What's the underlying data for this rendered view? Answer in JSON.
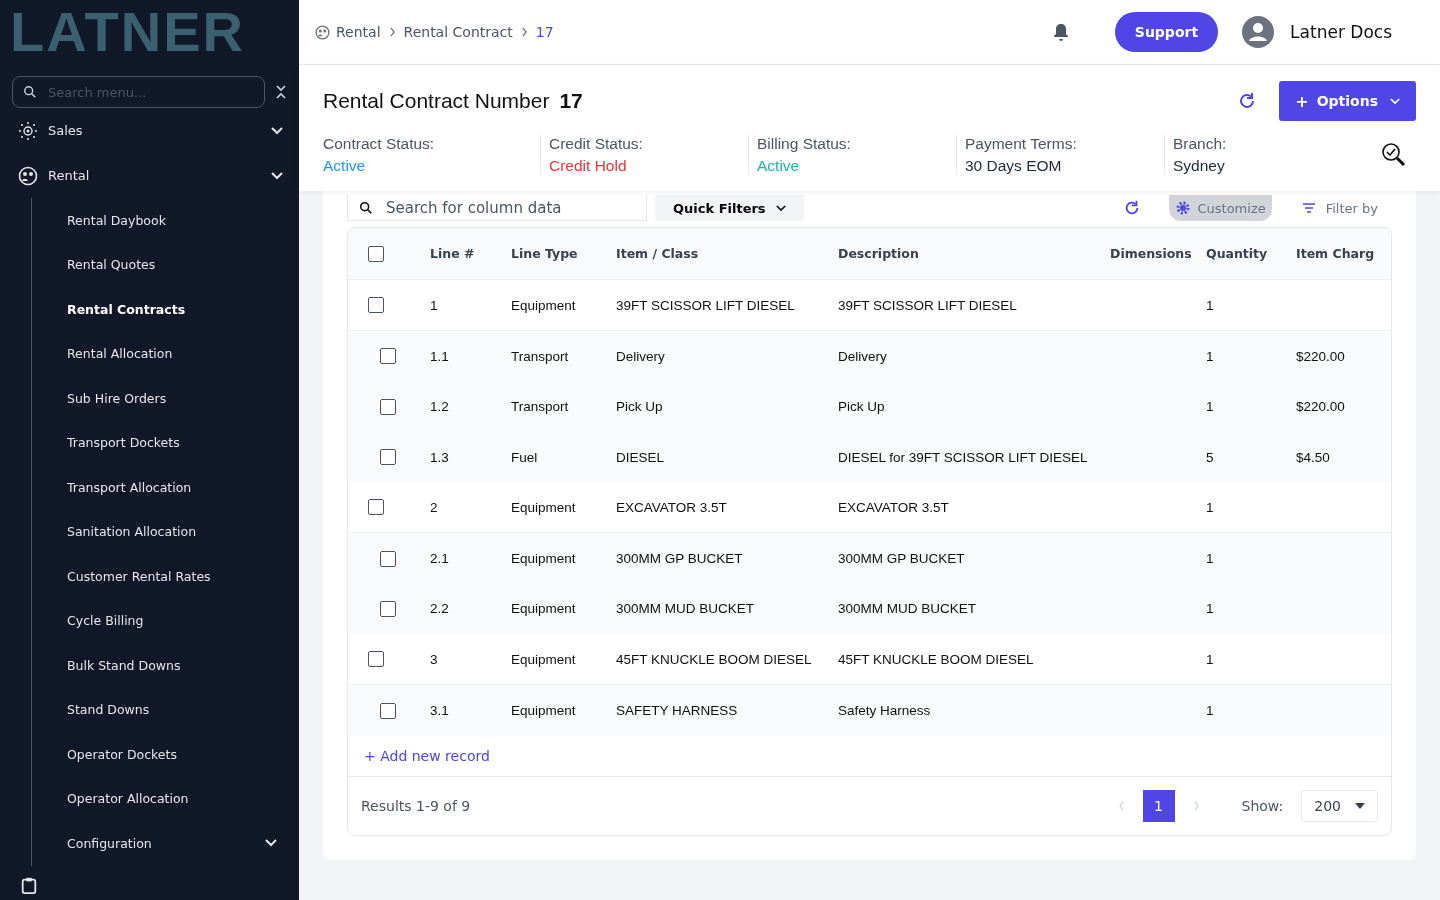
{
  "logo": "LATNER",
  "sidebar": {
    "search_placeholder": "Search menu...",
    "sections": [
      {
        "label": "Sales"
      },
      {
        "label": "Rental",
        "children": [
          {
            "label": "Rental Daybook",
            "selected": false
          },
          {
            "label": "Rental Quotes",
            "selected": false
          },
          {
            "label": "Rental Contracts",
            "selected": true
          },
          {
            "label": "Rental Allocation",
            "selected": false
          },
          {
            "label": "Sub Hire Orders",
            "selected": false
          },
          {
            "label": "Transport Dockets",
            "selected": false
          },
          {
            "label": "Transport Allocation",
            "selected": false
          },
          {
            "label": "Sanitation Allocation",
            "selected": false
          },
          {
            "label": "Customer Rental Rates",
            "selected": false
          },
          {
            "label": "Cycle Billing",
            "selected": false
          },
          {
            "label": "Bulk Stand Downs",
            "selected": false
          },
          {
            "label": "Stand Downs",
            "selected": false
          },
          {
            "label": "Operator Dockets",
            "selected": false
          },
          {
            "label": "Operator Allocation",
            "selected": false
          },
          {
            "label": "Configuration",
            "selected": false,
            "has_submenu": true
          }
        ]
      }
    ]
  },
  "breadcrumb": [
    "Rental",
    "Rental Contract",
    "17"
  ],
  "topbar": {
    "support": "Support",
    "user": "Latner Docs"
  },
  "header": {
    "title": "Rental Contract Number",
    "number": "17",
    "options_icon": "+",
    "options": "Options",
    "statuses": [
      {
        "label": "Contract Status:",
        "value": "Active",
        "color": "#2196f3"
      },
      {
        "label": "Credit Status:",
        "value": "Credit Hold",
        "color": "#e53935"
      },
      {
        "label": "Billing Status:",
        "value": "Active",
        "color": "#14b8a6"
      },
      {
        "label": "Payment Terms:",
        "value": "30 Days EOM",
        "color": "#1f2937"
      },
      {
        "label": "Branch:",
        "value": "Sydney",
        "color": "#1f2937"
      }
    ]
  },
  "toolbar": {
    "search_placeholder": "Search for column data",
    "quick_filters": "Quick Filters",
    "customize": "Customize",
    "filter_by": "Filter by"
  },
  "table": {
    "all_checked": false,
    "columns": [
      "Line #",
      "Line Type",
      "Item / Class",
      "Description",
      "Dimensions",
      "Quantity",
      "Item Charg"
    ],
    "rows": [
      {
        "kind": "parent",
        "checked": false,
        "cells": [
          "1",
          "Equipment",
          "39FT SCISSOR LIFT DIESEL",
          "39FT SCISSOR LIFT DIESEL",
          "",
          "1",
          ""
        ]
      },
      {
        "kind": "child",
        "checked": false,
        "cells": [
          "1.1",
          "Transport",
          "Delivery",
          "Delivery",
          "",
          "1",
          "$220.00"
        ]
      },
      {
        "kind": "child",
        "checked": false,
        "cells": [
          "1.2",
          "Transport",
          "Pick Up",
          "Pick Up",
          "",
          "1",
          "$220.00"
        ]
      },
      {
        "kind": "child",
        "checked": false,
        "cells": [
          "1.3",
          "Fuel",
          "DIESEL",
          "DIESEL for 39FT SCISSOR LIFT DIESEL",
          "",
          "5",
          "$4.50"
        ]
      },
      {
        "kind": "parent",
        "checked": false,
        "cells": [
          "2",
          "Equipment",
          "EXCAVATOR 3.5T",
          "EXCAVATOR 3.5T",
          "",
          "1",
          ""
        ]
      },
      {
        "kind": "child",
        "checked": false,
        "cells": [
          "2.1",
          "Equipment",
          "300MM GP BUCKET",
          "300MM GP BUCKET",
          "",
          "1",
          ""
        ]
      },
      {
        "kind": "child",
        "checked": false,
        "cells": [
          "2.2",
          "Equipment",
          "300MM MUD BUCKET",
          "300MM MUD BUCKET",
          "",
          "1",
          ""
        ]
      },
      {
        "kind": "parent",
        "checked": false,
        "cells": [
          "3",
          "Equipment",
          "45FT KNUCKLE BOOM DIESEL",
          "45FT KNUCKLE BOOM DIESEL",
          "",
          "1",
          ""
        ]
      },
      {
        "kind": "child",
        "checked": false,
        "cells": [
          "3.1",
          "Equipment",
          "SAFETY HARNESS",
          "Safety Harness",
          "",
          "1",
          ""
        ]
      }
    ],
    "add_record": "+ Add new record"
  },
  "footer": {
    "results": "Results 1-9 of 9",
    "pages": [
      {
        "label": "1",
        "selected": true
      }
    ],
    "show_label": "Show:",
    "page_size": "200"
  }
}
